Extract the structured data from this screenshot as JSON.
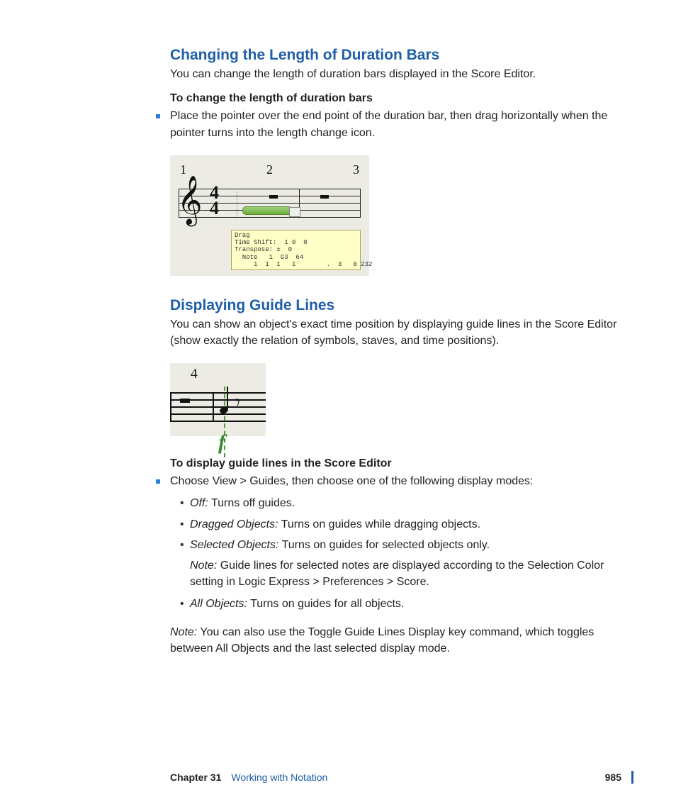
{
  "section1": {
    "title": "Changing the Length of Duration Bars",
    "intro": "You can change the length of duration bars displayed in the Score Editor.",
    "subhead": "To change the length of duration bars",
    "bullet": "Place the pointer over the end point of the duration bar, then drag horizontally when the pointer turns into the length change icon.",
    "fig": {
      "bar1": "1",
      "bar2": "2",
      "bar3": "3",
      "ts_top": "4",
      "ts_bot": "4",
      "tooltip": "Drag\nTime Shift:  1 0  0\nTranspose: ±  0\n  Note   1  G3  64\n     1  1  1   1        .  3   0 232"
    }
  },
  "section2": {
    "title": "Displaying Guide Lines",
    "intro": "You can show an object's exact time position by displaying guide lines in the Score Editor (show exactly the relation of symbols, staves, and time positions).",
    "fig": {
      "num": "4",
      "dynamic": "f"
    },
    "subhead": "To display guide lines in the Score Editor",
    "instruction": "Choose View > Guides, then choose one of the following display modes:",
    "modes": [
      {
        "term": "Off:",
        "desc": "Turns off guides."
      },
      {
        "term": "Dragged Objects:",
        "desc": "Turns on guides while dragging objects."
      },
      {
        "term": "Selected Objects:",
        "desc": "Turns on guides for selected objects only."
      },
      {
        "term": "All Objects:",
        "desc": "Turns on guides for all objects."
      }
    ],
    "nested_note_label": "Note:",
    "nested_note": "Guide lines for selected notes are displayed according to the Selection Color setting in Logic Express > Preferences > Score.",
    "final_note_label": "Note:",
    "final_note": "You can also use the Toggle Guide Lines Display key command, which toggles between All Objects and the last selected display mode."
  },
  "footer": {
    "chapter_label": "Chapter 31",
    "chapter_title": "Working with Notation",
    "page": "985"
  }
}
